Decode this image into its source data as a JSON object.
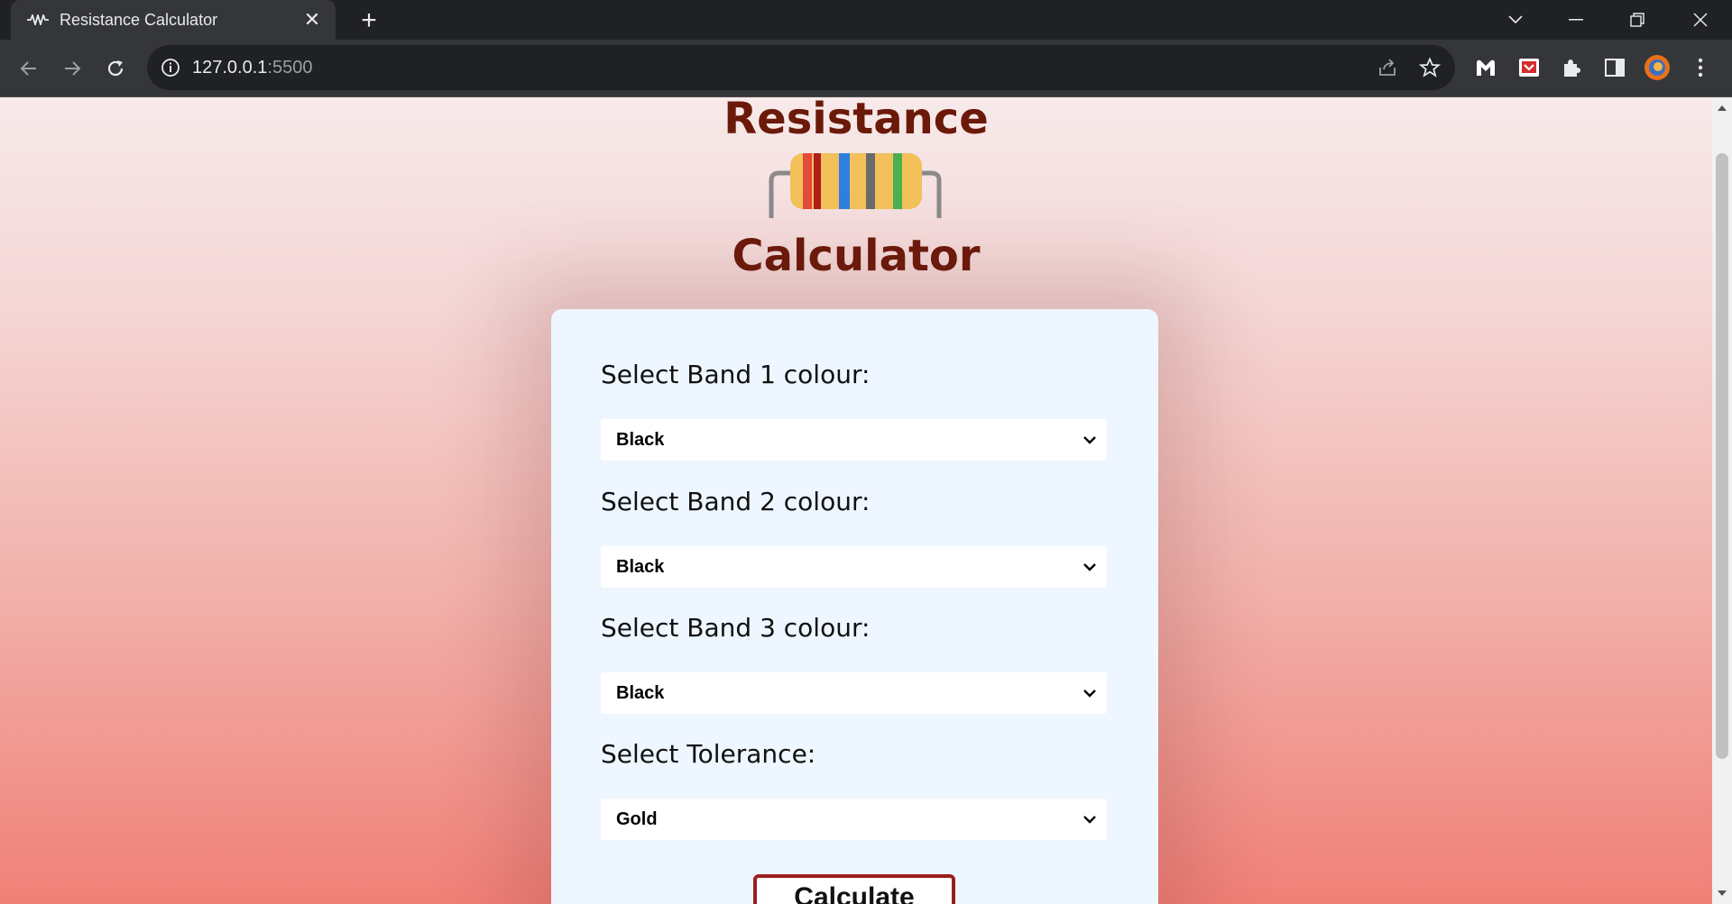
{
  "browser": {
    "tab_title": "Resistance Calculator",
    "url_host": "127.0.0.1",
    "url_port": ":5500",
    "icons": [
      "back-icon",
      "forward-icon",
      "reload-icon",
      "info-icon",
      "share-icon",
      "star-icon",
      "malwarebytes-icon",
      "pocket-icon",
      "puzzle-icon",
      "sidepanel-icon",
      "profile-avatar"
    ]
  },
  "page": {
    "title_top": "Resistance",
    "title_bottom": "Calculator",
    "fields": [
      {
        "label": "Select Band 1 colour:",
        "value": "Black"
      },
      {
        "label": "Select Band 2 colour:",
        "value": "Black"
      },
      {
        "label": "Select Band 3 colour:",
        "value": "Black"
      },
      {
        "label": "Select Tolerance:",
        "value": "Gold"
      }
    ],
    "calculate_label": "Calculate"
  },
  "colors": {
    "title": "#6b1a0a",
    "card": "#eef6ff",
    "button_border": "#9a1f1f"
  }
}
